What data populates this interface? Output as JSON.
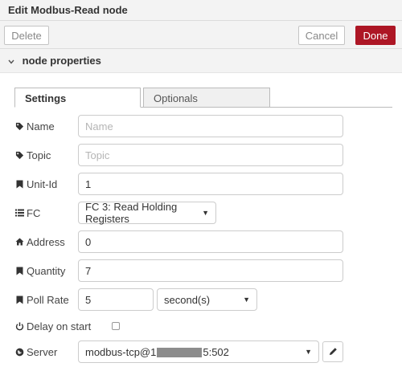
{
  "dialog": {
    "title": "Edit Modbus-Read node"
  },
  "toolbar": {
    "delete_label": "Delete",
    "cancel_label": "Cancel",
    "done_label": "Done"
  },
  "section": {
    "title": "node properties"
  },
  "tabs": [
    {
      "label": "Settings",
      "active": true
    },
    {
      "label": "Optionals",
      "active": false
    }
  ],
  "form": {
    "name": {
      "label": "Name",
      "value": "",
      "placeholder": "Name"
    },
    "topic": {
      "label": "Topic",
      "value": "",
      "placeholder": "Topic"
    },
    "unit_id": {
      "label": "Unit-Id",
      "value": "1"
    },
    "fc": {
      "label": "FC",
      "selected": "FC 3: Read Holding Registers"
    },
    "address": {
      "label": "Address",
      "value": "0"
    },
    "quantity": {
      "label": "Quantity",
      "value": "7"
    },
    "poll_rate": {
      "label": "Poll Rate",
      "value": "5",
      "unit_selected": "second(s)"
    },
    "delay_on_start": {
      "label": "Delay on start",
      "checked": false
    },
    "server": {
      "label": "Server",
      "value_prefix": "modbus-tcp@1",
      "value_suffix": "5:502"
    }
  },
  "colors": {
    "done_button": "#ad1625",
    "header_bg": "#f3f3f3"
  },
  "icons": {
    "name": "tag-icon",
    "topic": "tag-icon",
    "unit_id": "bookmark-icon",
    "fc": "list-icon",
    "address": "home-icon",
    "quantity": "bookmark-icon",
    "poll_rate": "bookmark-icon",
    "delay_on_start": "power-icon",
    "server": "globe-icon",
    "edit": "pencil-icon"
  }
}
